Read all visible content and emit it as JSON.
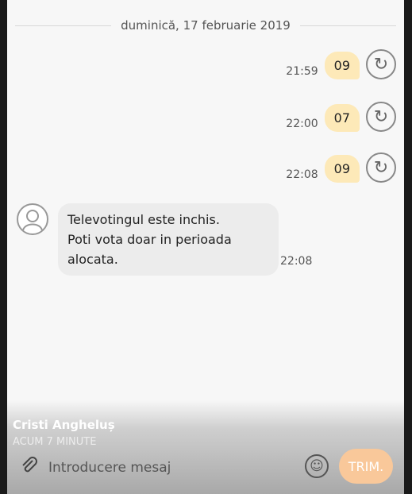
{
  "date_separator": "duminică, 17 februarie 2019",
  "outgoing": [
    {
      "text": "09",
      "time": "21:59",
      "icon": "resend-icon"
    },
    {
      "text": "07",
      "time": "22:00",
      "icon": "resend-icon"
    },
    {
      "text": "09",
      "time": "22:08",
      "icon": "resend-icon"
    }
  ],
  "incoming": {
    "text_lines": [
      "Televotingul este inchis.",
      "Poti vota doar in perioada",
      "alocata."
    ],
    "time": "22:08"
  },
  "overlay": {
    "author": "Cristi Angheluș",
    "ago": "ACUM 7 MINUTE"
  },
  "composer": {
    "placeholder": "Introducere mesaj",
    "send_label": "TRIM.",
    "attach_icon": "paperclip-icon",
    "emoji_icon": "emoji-icon"
  },
  "colors": {
    "outgoing_bubble": "#fde9b8",
    "incoming_bubble": "#ececec",
    "send_button": "#f9c89a"
  }
}
